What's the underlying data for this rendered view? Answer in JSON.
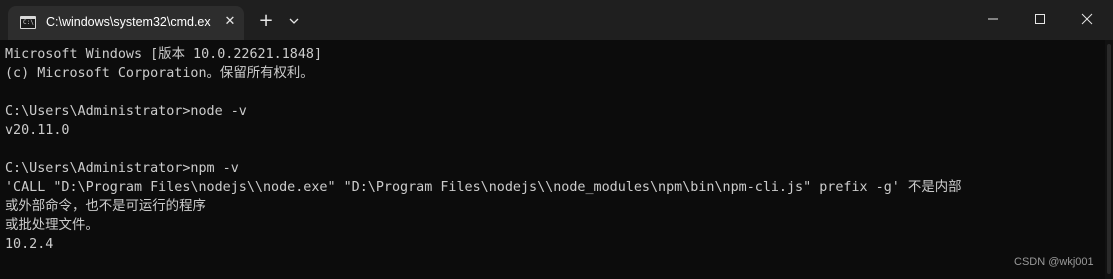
{
  "window": {
    "tab_title": "C:\\windows\\system32\\cmd.ex",
    "tab_icon": "terminal-icon",
    "tab_close_glyph": "✕",
    "new_tab_glyph": "+",
    "colors": {
      "titlebar": "#1f1f1f",
      "active_tab": "#2d2d2d",
      "console_background": "#0c0c0c",
      "console_text": "#cccccc"
    }
  },
  "console": {
    "lines": [
      "Microsoft Windows [版本 10.0.22621.1848]",
      "(c) Microsoft Corporation。保留所有权利。",
      "",
      "C:\\Users\\Administrator>node -v",
      "v20.11.0",
      "",
      "C:\\Users\\Administrator>npm -v",
      "'CALL \"D:\\Program Files\\nodejs\\\\node.exe\" \"D:\\Program Files\\nodejs\\\\node_modules\\npm\\bin\\npm-cli.js\" prefix -g' 不是内部",
      "或外部命令，也不是可运行的程序",
      "或批处理文件。",
      "10.2.4"
    ]
  },
  "watermark": "CSDN @wkj001"
}
